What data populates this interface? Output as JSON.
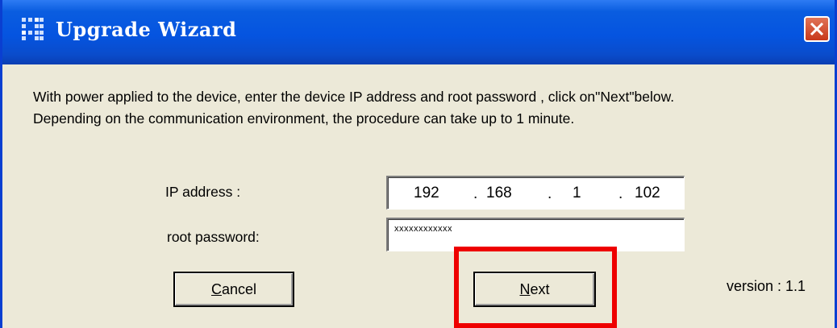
{
  "window": {
    "title": "Upgrade Wizard",
    "icons": {
      "app": "wizard-app-icon",
      "close": "close-icon"
    }
  },
  "description": {
    "line1": "With power applied to the device, enter the device IP address and root password , click on\"Next\"below.",
    "line2": "Depending on the communication environment, the procedure can take up to 1 minute."
  },
  "form": {
    "ip_label": "IP address :",
    "ip_octets": [
      "192",
      "168",
      "1",
      "102"
    ],
    "ip_separator": ".",
    "password_label": "root password:",
    "password_value": "xxxxxxxxxxxx"
  },
  "buttons": {
    "cancel_accel": "C",
    "cancel_rest": "ancel",
    "next_accel": "N",
    "next_rest": "ext"
  },
  "version_text": "version : 1.1",
  "colors": {
    "titlebar": "#0554e0",
    "dialog_bg": "#ece9d8",
    "highlight": "#ee0000",
    "close_button": "#c8381a"
  }
}
